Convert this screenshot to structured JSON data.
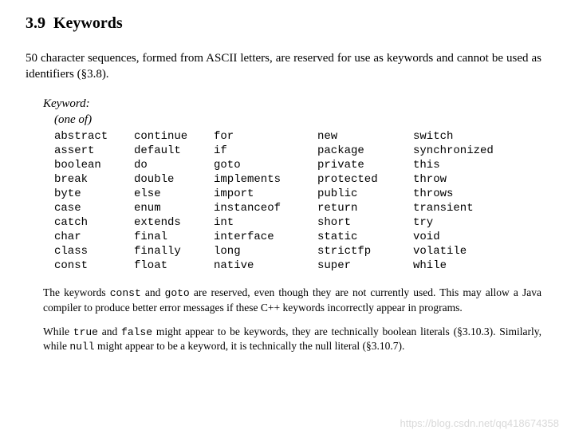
{
  "heading": {
    "number": "3.9",
    "title": "Keywords"
  },
  "intro": {
    "count": "50",
    "text_a": " character sequences, formed from ASCII letters, are reserved for use as keywords and cannot be used as identifiers (",
    "ref": "§3.8",
    "text_b": ")."
  },
  "grammar": {
    "head": "Keyword:",
    "sub": "(one of)"
  },
  "keywords": [
    [
      "abstract",
      "continue",
      "for",
      "new",
      "switch"
    ],
    [
      "assert",
      "default",
      "if",
      "package",
      "synchronized"
    ],
    [
      "boolean",
      "do",
      "goto",
      "private",
      "this"
    ],
    [
      "break",
      "double",
      "implements",
      "protected",
      "throw"
    ],
    [
      "byte",
      "else",
      "import",
      "public",
      "throws"
    ],
    [
      "case",
      "enum",
      "instanceof",
      "return",
      "transient"
    ],
    [
      "catch",
      "extends",
      "int",
      "short",
      "try"
    ],
    [
      "char",
      "final",
      "interface",
      "static",
      "void"
    ],
    [
      "class",
      "finally",
      "long",
      "strictfp",
      "volatile"
    ],
    [
      "const",
      "float",
      "native",
      "super",
      "while"
    ]
  ],
  "note1": {
    "a": "The keywords ",
    "k1": "const",
    "mid": " and ",
    "k2": "goto",
    "b": " are reserved, even though they are not currently used. This may allow a Java compiler to produce better error messages if these C++ keywords incorrectly appear in programs."
  },
  "note2": {
    "a": "While ",
    "k1": "true",
    "mid1": " and ",
    "k2": "false",
    "b": " might appear to be keywords, they are technically boolean literals (",
    "ref1": "§3.10.3",
    "c": "). Similarly, while ",
    "k3": "null",
    "d": " might appear to be a keyword, it is technically the null literal (",
    "ref2": "§3.10.7",
    "e": ")."
  },
  "watermark": "https://blog.csdn.net/qq418674358"
}
